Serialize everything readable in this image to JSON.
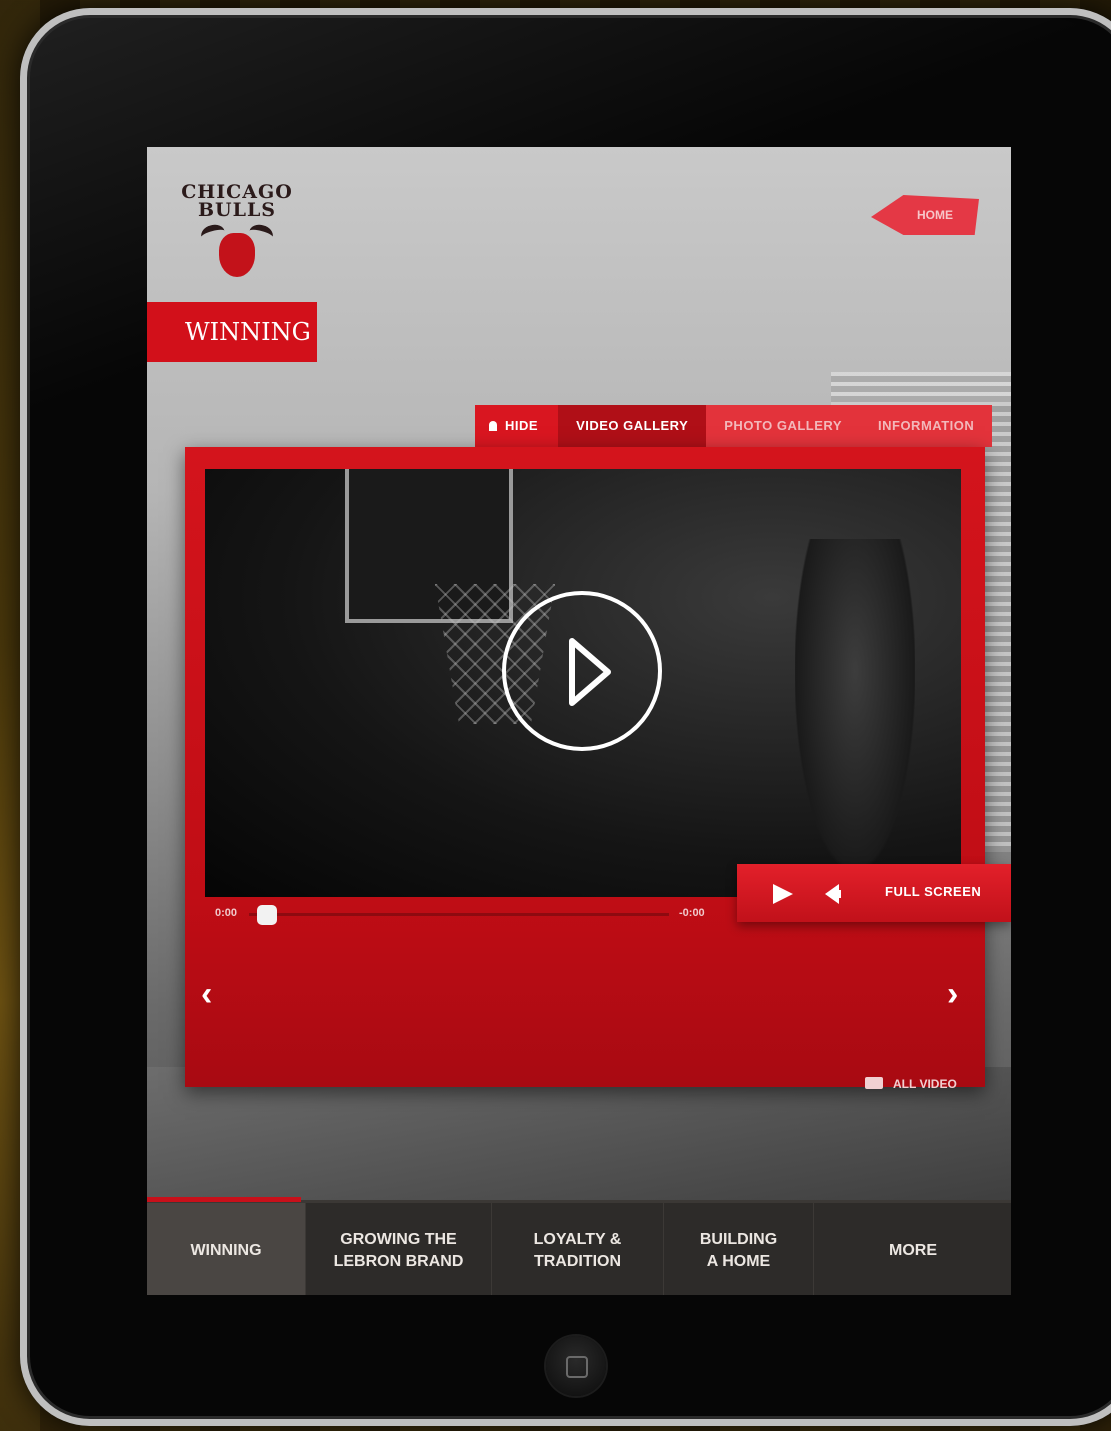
{
  "brand": {
    "line1": "CHICAGO",
    "line2": "BULLS"
  },
  "section_title": "WINNING",
  "home_button": "HOME",
  "tabs": {
    "hide": "HIDE",
    "video_gallery": "VIDEO GALLERY",
    "photo_gallery": "PHOTO GALLERY",
    "information": "INFORMATION"
  },
  "player": {
    "current_time": "0:00",
    "remaining_time": "-0:00",
    "progress": 0,
    "full_screen_label": "FULL SCREEN",
    "all_video_label": "ALL VIDEO",
    "prev_label": "‹",
    "next_label": "›"
  },
  "bottom_nav": [
    {
      "label": "WINNING"
    },
    {
      "label": "GROWING THE LEBRON BRAND"
    },
    {
      "label": "LOYALTY & TRADITION"
    },
    {
      "label": "BUILDING A HOME"
    },
    {
      "label": "MORE"
    }
  ],
  "colors": {
    "accent": "#d2101a",
    "nav_bg": "#2d2b29"
  }
}
